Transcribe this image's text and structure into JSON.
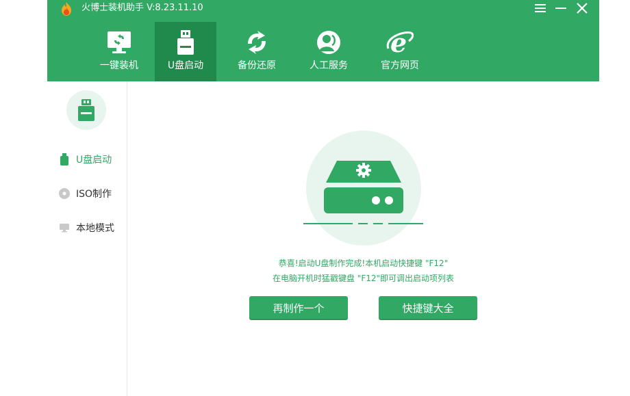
{
  "app": {
    "title": "火博士装机助手 V:8.23.11.10"
  },
  "colors": {
    "accent": "#31a863",
    "accent_dark": "#1f8a4b",
    "light_green": "#e8f5ee"
  },
  "window_controls": [
    {
      "name": "menu-icon"
    },
    {
      "name": "minimize-icon"
    },
    {
      "name": "close-icon"
    }
  ],
  "nav": {
    "tabs": [
      {
        "label": "一键装机",
        "icon": "monitor-install-icon",
        "active": false
      },
      {
        "label": "U盘启动",
        "icon": "usb-drive-icon",
        "active": true
      },
      {
        "label": "备份还原",
        "icon": "backup-restore-icon",
        "active": false
      },
      {
        "label": "人工服务",
        "icon": "customer-service-icon",
        "active": false
      },
      {
        "label": "官方网页",
        "icon": "browser-ie-icon",
        "active": false
      }
    ]
  },
  "sidebar": {
    "header_icon": "usb-drive-icon",
    "items": [
      {
        "label": "U盘启动",
        "icon": "usb-small-icon",
        "active": true
      },
      {
        "label": "ISO制作",
        "icon": "disc-icon",
        "active": false
      },
      {
        "label": "本地模式",
        "icon": "monitor-small-icon",
        "active": false
      }
    ]
  },
  "main": {
    "illustration_icon": "drive-gear-icon",
    "message_line1": "恭喜!启动U盘制作完成!本机启动快捷键 \"F12\"",
    "message_line2": "在电脑开机时猛戳键盘 \"F12\"即可调出启动项列表",
    "buttons": {
      "remake": "再制作一个",
      "shortcuts": "快捷键大全"
    }
  }
}
